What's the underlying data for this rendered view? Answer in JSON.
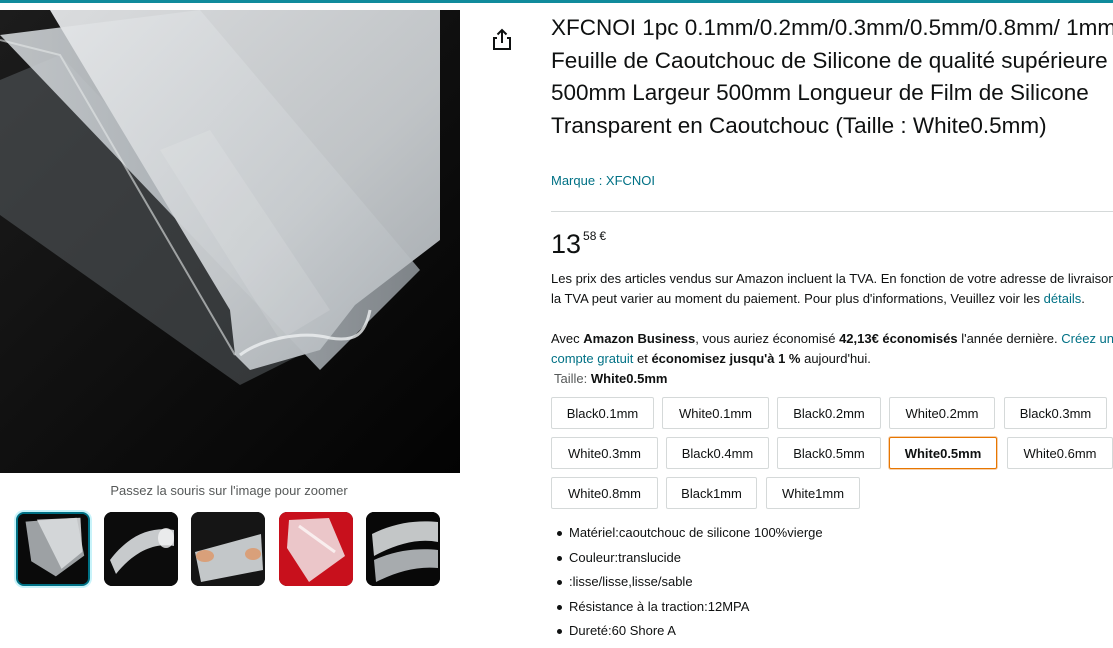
{
  "product": {
    "title": "XFCNOI 1pc 0.1mm/0.2mm/0.3mm/0.5mm/0.8mm/ 1mm Feuille de Caoutchouc de Silicone de qualité supérieure 500mm Largeur 500mm Longueur de Film de Silicone Transparent en Caoutchouc (Taille : White0.5mm)",
    "brand_link": "Marque : XFCNOI"
  },
  "price": {
    "whole": "13",
    "fraction": "58",
    "currency": "€"
  },
  "tax_note": {
    "text": "Les prix des articles vendus sur Amazon incluent la TVA. En fonction de votre adresse de livraison, la TVA peut varier au moment du paiement. Pour plus d'informations, Veuillez voir les ",
    "link": "détails",
    "end": "."
  },
  "business": {
    "prefix": "Avec ",
    "name": "Amazon Business",
    "middle": ", vous auriez économisé ",
    "amount": "42,13€ économisés",
    "middle2": " l'année dernière. ",
    "link": "Créez un compte gratuit",
    "middle3": " et ",
    "bold2": "économisez jusqu'à 1 %",
    "suffix": " aujourd'hui."
  },
  "size": {
    "label": "Taille:",
    "selected": "White0.5mm",
    "options": [
      "Black0.1mm",
      "White0.1mm",
      "Black0.2mm",
      "White0.2mm",
      "Black0.3mm",
      "White0.3mm",
      "Black0.4mm",
      "Black0.5mm",
      "White0.5mm",
      "White0.6mm",
      "White0.8mm",
      "Black1mm",
      "White1mm"
    ]
  },
  "bullets": [
    "Matériel:caoutchouc de silicone 100%vierge",
    "Couleur:translucide",
    ":lisse/lisse,lisse/sable",
    "Résistance à la traction:12MPA",
    "Dureté:60 Shore A"
  ],
  "gallery": {
    "zoom_hint": "Passez la souris sur l'image pour zoomer",
    "thumbnail_count": 5,
    "selected_thumbnail": 1
  },
  "colors": {
    "link": "#007185",
    "selected_outline": "#e77600",
    "thumb_selected": "#007185",
    "accent_bar": "#108b9c"
  },
  "icons": {
    "share": "share-icon"
  }
}
